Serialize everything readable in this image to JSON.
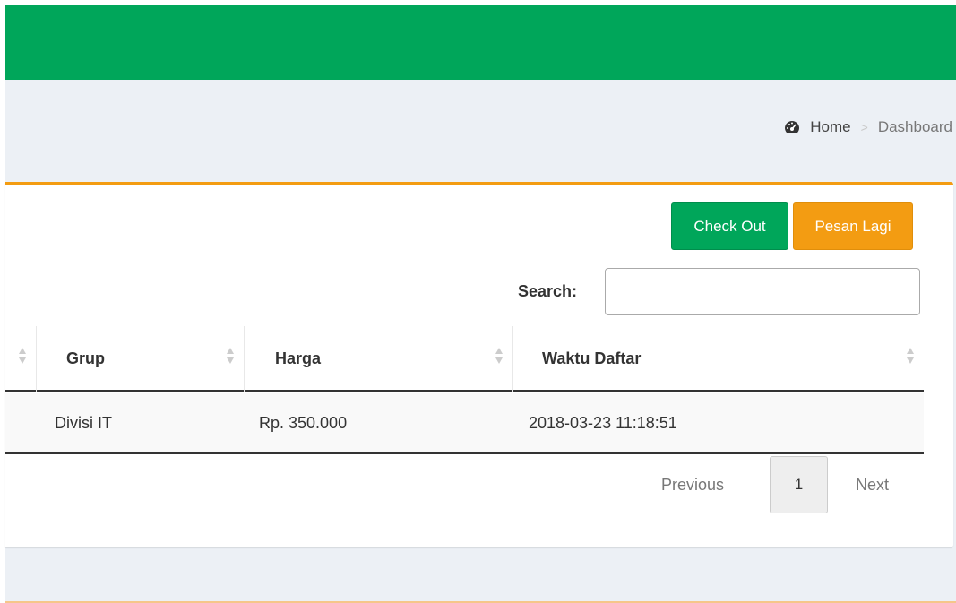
{
  "colors": {
    "header_green": "#00a65a",
    "box_border_orange": "#f39c12",
    "content_bg": "#ecf0f5"
  },
  "breadcrumb": {
    "icon": "dashboard-icon",
    "home": "Home",
    "separator": ">",
    "current": "Dashboard"
  },
  "actions": {
    "checkout": "Check Out",
    "pesan_lagi": "Pesan Lagi"
  },
  "search": {
    "label": "Search:",
    "value": ""
  },
  "table": {
    "columns": [
      "Grup",
      "Harga",
      "Waktu Daftar"
    ],
    "rows": [
      [
        "Divisi IT",
        "Rp. 350.000",
        "2018-03-23 11:18:51"
      ]
    ]
  },
  "pagination": {
    "previous": "Previous",
    "current_page": "1",
    "next": "Next"
  }
}
